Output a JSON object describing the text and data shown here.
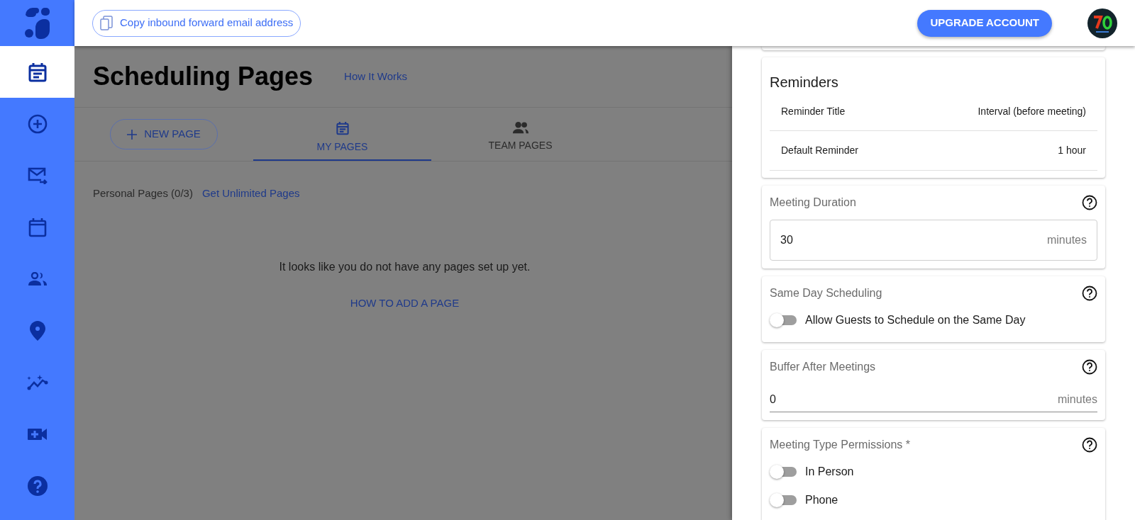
{
  "sidebar": {
    "items": [
      {
        "selected": true
      },
      {
        "selected": false
      },
      {
        "selected": false
      },
      {
        "selected": false
      },
      {
        "selected": false
      },
      {
        "selected": false
      },
      {
        "selected": false
      },
      {
        "selected": false
      },
      {
        "selected": false
      }
    ]
  },
  "header": {
    "copy_button": "Copy inbound forward email address",
    "upgrade_button": "UPGRADE ACCOUNT"
  },
  "main": {
    "title": "Scheduling Pages",
    "help_link": "How It Works",
    "new_page_button": "NEW PAGE",
    "tabs": [
      {
        "label": "MY PAGES",
        "selected": true
      },
      {
        "label": "TEAM PAGES",
        "selected": false
      }
    ],
    "personal_pages": "Personal Pages (0/3)",
    "unlimited_link": "Get Unlimited Pages",
    "empty_message": "It looks like you do not have any pages set up yet.",
    "how_to_link": "HOW TO ADD A PAGE"
  },
  "drawer": {
    "reminders": {
      "title": "Reminders",
      "columns": [
        "Reminder Title",
        "Interval (before meeting)"
      ],
      "rows": [
        [
          "Default Reminder",
          "1 hour"
        ]
      ]
    },
    "sections": [
      {
        "kind": "outlined_input",
        "label": "Meeting Duration",
        "value": "30",
        "unit": "minutes"
      },
      {
        "kind": "toggles",
        "label": "Same Day Scheduling",
        "toggles": [
          {
            "label": "Allow Guests to Schedule on the Same Day",
            "on": false
          }
        ]
      },
      {
        "kind": "underlined_input",
        "label": "Buffer After Meetings",
        "value": "0",
        "unit": "minutes"
      },
      {
        "kind": "toggles",
        "label": "Meeting Type Permissions *",
        "toggles": [
          {
            "label": "In Person",
            "on": false
          },
          {
            "label": "Phone",
            "on": false
          }
        ]
      }
    ]
  }
}
